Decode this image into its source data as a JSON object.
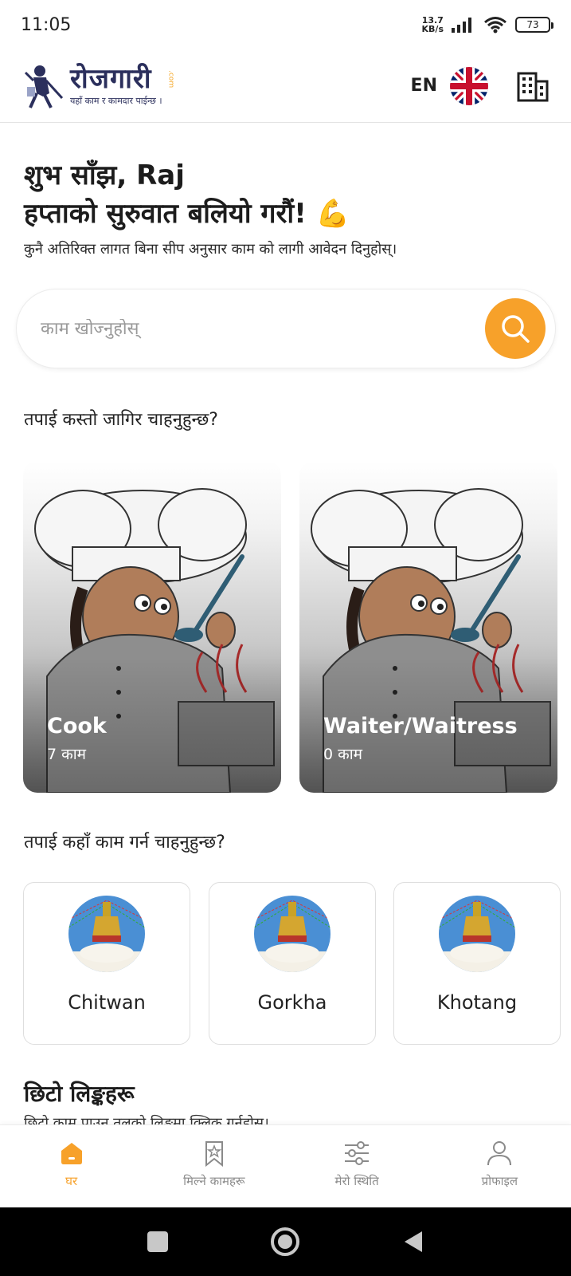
{
  "status_bar": {
    "time": "11:05",
    "net_speed_value": "13.7",
    "net_speed_unit": "KB/s",
    "battery": "73"
  },
  "header": {
    "logo_text": "रोजगारी",
    "logo_tagline": "यहाँ काम र कामदार पाईन्छ ।",
    "logo_dotcom": ".com",
    "language_code": "EN"
  },
  "greeting": {
    "line1": "शुभ साँझ, Raj",
    "line2": "हप्ताको सुरुवात बलियो गरौं! 💪",
    "subtitle": "कुनै अतिरिक्त लागत बिना सीप अनुसार काम को लागी आवेदन दिनुहोस्।"
  },
  "search": {
    "placeholder": "काम खोज्नुहोस्"
  },
  "job_section": {
    "title": "तपाई कस्तो जागिर चाहनुहुन्छ?",
    "jobs": [
      {
        "title": "Cook",
        "count": "7 काम"
      },
      {
        "title": "Waiter/Waitress",
        "count": "0 काम"
      }
    ]
  },
  "location_section": {
    "title": "तपाई कहाँ काम गर्न चाहनुहुन्छ?",
    "locations": [
      {
        "name": "Chitwan"
      },
      {
        "name": "Gorkha"
      },
      {
        "name": "Khotang"
      }
    ]
  },
  "quick_links": {
    "title": "छिटो लिङ्कहरू",
    "subtitle": "छिटो काम पाउन तलको लिङ्कमा क्लिक गर्नुहोस्।"
  },
  "bottom_nav": {
    "items": [
      {
        "label": "घर",
        "icon": "home-icon",
        "active": true
      },
      {
        "label": "मिल्ने कामहरू",
        "icon": "bookmark-star-icon",
        "active": false
      },
      {
        "label": "मेरो स्थिति",
        "icon": "sliders-icon",
        "active": false
      },
      {
        "label": "प्रोफाइल",
        "icon": "user-icon",
        "active": false
      }
    ]
  },
  "colors": {
    "accent": "#f7a12a",
    "brand_navy": "#2b2f5c"
  }
}
